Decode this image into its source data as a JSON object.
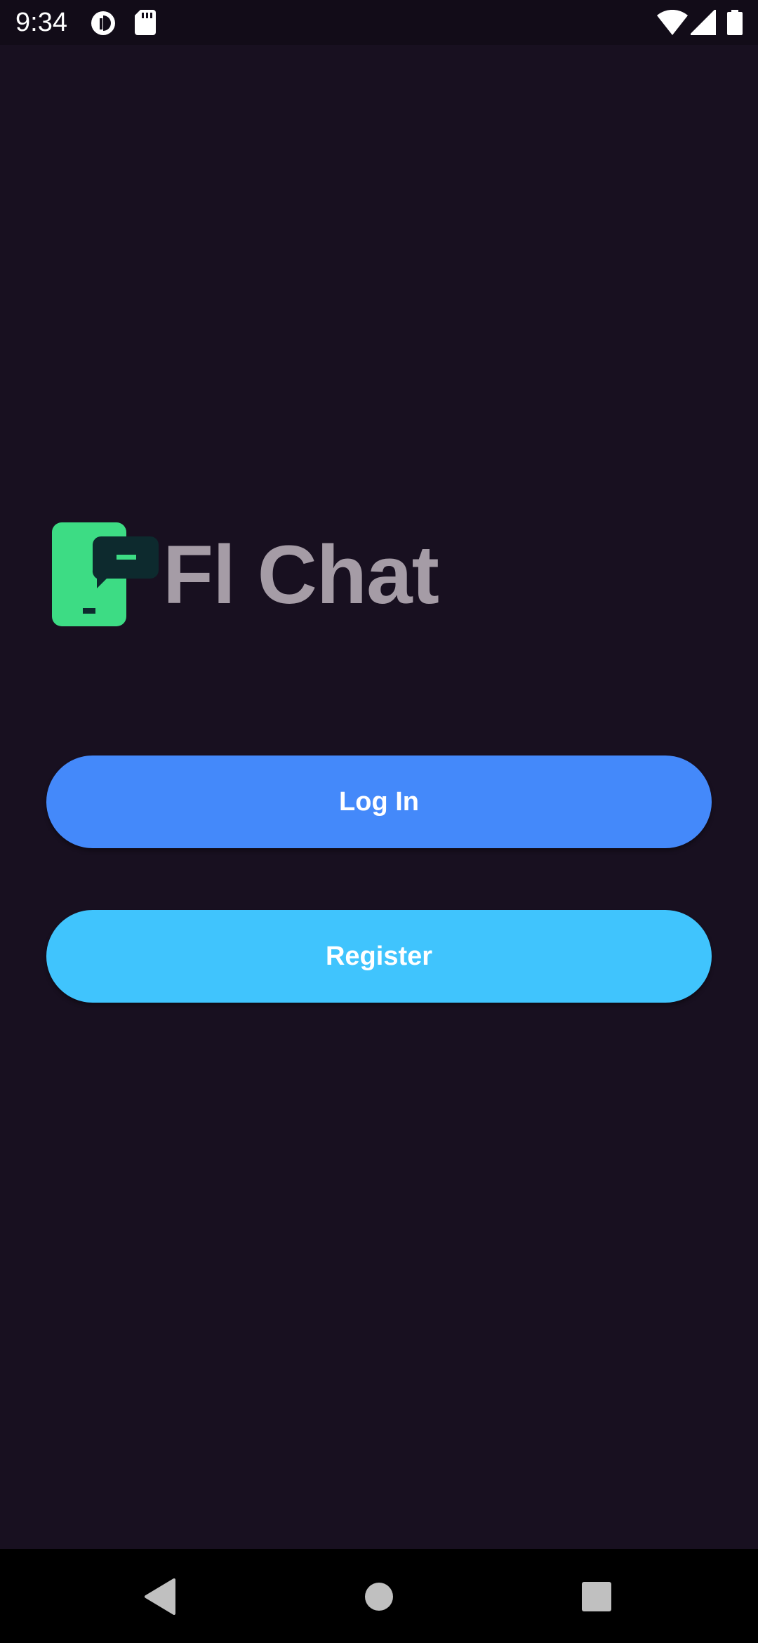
{
  "status_bar": {
    "time": "9:34",
    "icons": [
      "app-notification-icon",
      "sd-card-icon",
      "wifi-icon",
      "cellular-signal-icon",
      "battery-icon"
    ]
  },
  "app": {
    "name": "Fl Chat",
    "logo_icon": "phone-chat-logo-icon"
  },
  "actions": {
    "login_label": "Log In",
    "register_label": "Register"
  },
  "nav_bar": {
    "icons": [
      "back-icon",
      "home-icon",
      "recents-icon"
    ]
  },
  "colors": {
    "background": "#181020",
    "login_button": "#4489fa",
    "register_button": "#40c4fd",
    "logo_green": "#3ddc84",
    "logo_dark": "#0d2a2e",
    "app_name_text": "#a59ca6"
  }
}
